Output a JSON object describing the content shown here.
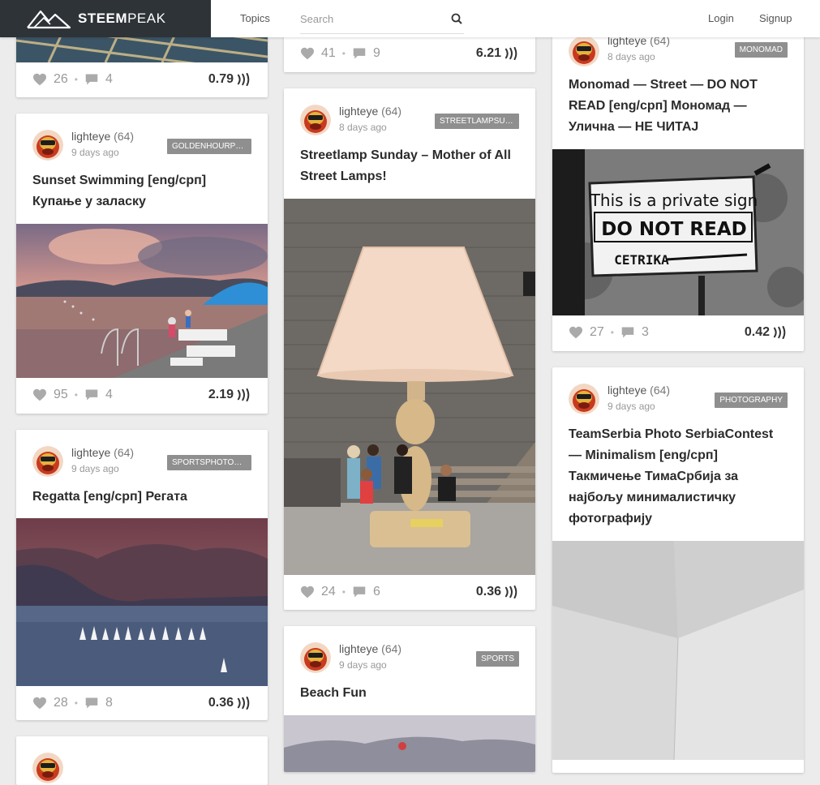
{
  "header": {
    "logo_primary": "STEEM",
    "logo_secondary": "PEAK",
    "nav_topics": "Topics",
    "search_placeholder": "Search",
    "login": "Login",
    "signup": "Signup"
  },
  "cards": {
    "c1": {
      "likes": "26",
      "comments": "4",
      "payout": "0.79"
    },
    "c2": {
      "author": "lighteye",
      "rep": "(64)",
      "age": "9 days ago",
      "tag": "GOLDENHOURPHO...",
      "title": "Sunset Swimming [eng/срп] Купање у заласку",
      "likes": "95",
      "comments": "4",
      "payout": "2.19"
    },
    "c3": {
      "author": "lighteye",
      "rep": "(64)",
      "age": "9 days ago",
      "tag": "SPORTSPHOTOGR...",
      "title": "Regatta [eng/срп] Регата",
      "likes": "28",
      "comments": "8",
      "payout": "0.36"
    },
    "c5": {
      "likes": "41",
      "comments": "9",
      "payout": "6.21"
    },
    "c6": {
      "author": "lighteye",
      "rep": "(64)",
      "age": "8 days ago",
      "tag": "STREETLAMPSUN...",
      "title": "Streetlamp Sunday – Mother of All Street Lamps!",
      "likes": "24",
      "comments": "6",
      "payout": "0.36"
    },
    "c7": {
      "author": "lighteye",
      "rep": "(64)",
      "age": "9 days ago",
      "tag": "SPORTS",
      "title": "Beach Fun"
    },
    "c8": {
      "author": "lighteye",
      "rep": "(64)",
      "age": "8 days ago",
      "tag": "MONOMAD",
      "title": "Monomad — Street — DO NOT READ [eng/срп] Мономад — Улична — НЕ ЧИТАЈ",
      "sign_line1": "This is a private sign",
      "sign_line2": "DO NOT READ",
      "sign_line3": "CETRIKA",
      "likes": "27",
      "comments": "3",
      "payout": "0.42"
    },
    "c9": {
      "author": "lighteye",
      "rep": "(64)",
      "age": "9 days ago",
      "tag": "PHOTOGRAPHY",
      "title": "TeamSerbia Photo SerbiaContest — Minimalism [eng/срп] Такмичење ТимаСрбија за најбољу минималистичку фотографију"
    }
  },
  "icons": {
    "like": "heart-icon",
    "comment": "comment-icon",
    "currency": "steem-icon",
    "search": "search-icon"
  }
}
